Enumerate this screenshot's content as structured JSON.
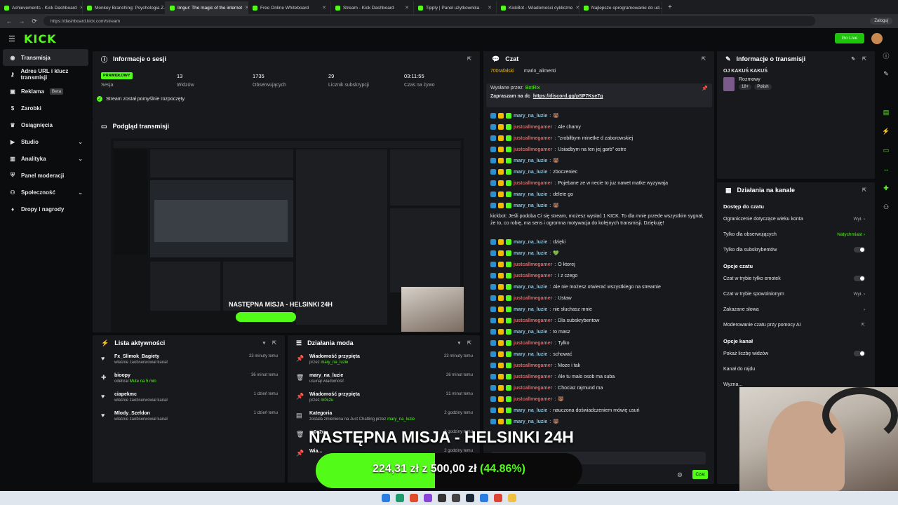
{
  "browser": {
    "tabs": [
      {
        "label": "Achievements - Kick Dashboard",
        "active": false
      },
      {
        "label": "Monkey Branching: Psychologia Z...",
        "active": false
      },
      {
        "label": "Imgur: The magic of the internet",
        "active": true
      },
      {
        "label": "Free Online Whiteboard",
        "active": false
      },
      {
        "label": "Stream - Kick Dashboard",
        "active": false
      },
      {
        "label": "Tipply | Panel użytkownika",
        "active": false
      },
      {
        "label": "KickBot - Wiadomości cykliczne",
        "active": false
      },
      {
        "label": "Najlepsze oprogramowanie do ud...",
        "active": false
      }
    ],
    "url": "https://dashboard.kick.com/stream",
    "profile_label": "Zaloguj"
  },
  "header": {
    "logo": "KICK",
    "golive_label": "Go Live"
  },
  "sidebar": {
    "items": [
      {
        "label": "Transmisja",
        "icon": "broadcast-icon",
        "active": true
      },
      {
        "label": "Adres URL i klucz transmisji",
        "icon": "key-icon"
      },
      {
        "label": "Reklama",
        "icon": "ad-icon",
        "badge": "Beta"
      },
      {
        "label": "Zarobki",
        "icon": "money-icon"
      },
      {
        "label": "Osiągnięcia",
        "icon": "trophy-icon"
      },
      {
        "label": "Studio",
        "icon": "studio-icon",
        "chevron": true
      },
      {
        "label": "Analityka",
        "icon": "chart-icon",
        "chevron": true
      },
      {
        "label": "Panel moderacji",
        "icon": "shield-icon"
      },
      {
        "label": "Społeczność",
        "icon": "community-icon",
        "chevron": true
      },
      {
        "label": "Dropy i nagrody",
        "icon": "gift-icon"
      }
    ]
  },
  "session": {
    "title": "Informacje o sesji",
    "status_badge": "PRAWIDŁOWY",
    "stats": [
      {
        "value": "",
        "label": "Sesja"
      },
      {
        "value": "13",
        "label": "Widzów"
      },
      {
        "value": "1735",
        "label": "Obserwujących"
      },
      {
        "value": "29",
        "label": "Licznik subskrypcji"
      },
      {
        "value": "03:11:55",
        "label": "Czas na żywo"
      }
    ],
    "message": "Stream został pomyślnie rozpoczęty."
  },
  "preview": {
    "title": "Podgląd transmisji"
  },
  "activity": {
    "title": "Lista aktywności",
    "items": [
      {
        "name": "Fx_Slimok_Bagiety",
        "sub": "właśnie zaobserwował kanał",
        "time": "23 minuty temu",
        "icon": "heart-icon"
      },
      {
        "name": "bioopy",
        "sub": "odebrał",
        "sub_hl": "Mute na 5 min",
        "time": "36 minut temu",
        "icon": "gift-icon"
      },
      {
        "name": "ciapekmc",
        "sub": "właśnie zaobserwował kanał",
        "time": "1 dzień temu",
        "icon": "heart-icon"
      },
      {
        "name": "Mlody_Szeldon",
        "sub": "właśnie zaobserwował kanał",
        "time": "1 dzień temu",
        "icon": "heart-icon"
      }
    ]
  },
  "modlog": {
    "title": "Działania moda",
    "items": [
      {
        "name": "Wiadomość przypięta",
        "sub": "przez",
        "sub_hl": "mary_na_luzie",
        "time": "23 minuty temu",
        "icon": "pin-icon"
      },
      {
        "name": "mary_na_luzie",
        "sub": "usunął wiadomość",
        "time": "26 minut temu",
        "icon": "trash-icon"
      },
      {
        "name": "Wiadomość przypięta",
        "sub": "przez",
        "sub_hl": "m0c2u",
        "time": "31 minut temu",
        "icon": "pin-icon"
      },
      {
        "name": "Kategoria",
        "sub": "została zmieniona na Just Chatting przez",
        "sub_hl": "mary_na_luzie",
        "time": "2 godziny temu",
        "icon": "tag-icon"
      },
      {
        "name": "m0c2u",
        "sub": "",
        "time": "2 godziny temu",
        "icon": "trash-icon"
      },
      {
        "name": "Wia...",
        "sub": "",
        "time": "2 godziny temu",
        "icon": "pin-icon"
      }
    ]
  },
  "chat": {
    "title": "Czat",
    "top_users": [
      "700rafalski",
      "mario_alimenti"
    ],
    "pinned_by": "Wysłane przez",
    "pinned_user": "BotRix",
    "pinned_text": "Zapraszam na dc",
    "pinned_link": "https://discord.gg/pSP7Kse7g",
    "messages": [
      {
        "user": "mary_na_luzie",
        "text": "🐻",
        "color": "m"
      },
      {
        "user": "justcallmegamer",
        "text": "Ale chamy",
        "color": "j"
      },
      {
        "user": "justcallmegamer",
        "text": "\"zrobiłbym minetke d zaborowskiej",
        "color": "j"
      },
      {
        "user": "justcallmegamer",
        "text": "Usiadbym na ten jej garb\" ostre",
        "color": "j"
      },
      {
        "user": "mary_na_luzie",
        "text": "🐻",
        "color": "m"
      },
      {
        "user": "mary_na_luzie",
        "text": "zboczeniec",
        "color": "m"
      },
      {
        "user": "justcallmegamer",
        "text": "Pojebane ze w necie to juz nawet matke wyzywaja",
        "color": "j"
      },
      {
        "user": "mary_na_luzie",
        "text": "delete go",
        "color": "m"
      },
      {
        "user": "mary_na_luzie",
        "text": "🐻",
        "color": "m"
      }
    ],
    "bot_message": "kickbot: Jeśli podoba Ci się stream, możesz wysłać 1 KICK. To dla mnie przede wszystkim sygnał, że to, co robię, ma sens i ogromna motywacja do kolejnych transmisji. Dziękuję!",
    "messages2": [
      {
        "user": "mary_na_luzie",
        "text": "dzięki",
        "color": "m"
      },
      {
        "user": "mary_na_luzie",
        "text": "💚",
        "color": "m"
      },
      {
        "user": "justcallmegamer",
        "text": "O ktorej",
        "color": "j"
      },
      {
        "user": "justcallmegamer",
        "text": "I z czego",
        "color": "j"
      },
      {
        "user": "mary_na_luzie",
        "text": "Ale nie możesz otwierać wszystkiego na streamie",
        "color": "m"
      },
      {
        "user": "justcallmegamer",
        "text": "Ustaw",
        "color": "j"
      },
      {
        "user": "mary_na_luzie",
        "text": "nie słuchasz mnie",
        "color": "m"
      },
      {
        "user": "justcallmegamer",
        "text": "Dla subskrybentow",
        "color": "j"
      },
      {
        "user": "mary_na_luzie",
        "text": "to masz",
        "color": "m"
      },
      {
        "user": "justcallmegamer",
        "text": "Tylko",
        "color": "j"
      },
      {
        "user": "mary_na_luzie",
        "text": "schować",
        "color": "m"
      },
      {
        "user": "justcallmegamer",
        "text": "Moze i tak",
        "color": "j"
      },
      {
        "user": "justcallmegamer",
        "text": "Ale tu malo osob ma suba",
        "color": "j"
      },
      {
        "user": "justcallmegamer",
        "text": "Chociaz rajmund ma",
        "color": "j"
      },
      {
        "user": "justcallmegamer",
        "text": "🐻",
        "color": "j"
      },
      {
        "user": "mary_na_luzie",
        "text": "nauczona doświadczeniem mówię usuń",
        "color": "m"
      },
      {
        "user": "mary_na_luzie",
        "text": "🐻",
        "color": "m"
      }
    ],
    "input_placeholder": "Wyślij wiadomość",
    "send_label": "Czat"
  },
  "info": {
    "title": "Informacje o transmisji",
    "stream_title": "OJ KAKUŚ KAKUŚ",
    "category": "Rozmowy",
    "tags": [
      "18+",
      "Polish"
    ]
  },
  "actions": {
    "title": "Działania na kanale",
    "sections": [
      {
        "heading": "Dostęp do czatu",
        "options": [
          {
            "label": "Ograniczenie dotyczące wieku konta",
            "value": "Wył.",
            "kind": "arrow"
          },
          {
            "label": "Tylko dla obserwujących",
            "value": "Natychmiast",
            "kind": "arrow-green"
          },
          {
            "label": "Tylko dla subskrybentów",
            "kind": "toggle"
          }
        ]
      },
      {
        "heading": "Opcje czatu",
        "options": [
          {
            "label": "Czat w trybie tylko emotek",
            "kind": "toggle"
          },
          {
            "label": "Czat w trybie spowolnionym",
            "value": "Wył.",
            "kind": "arrow"
          },
          {
            "label": "Zakazane słowa",
            "kind": "arrow"
          },
          {
            "label": "Moderowanie czatu przy pomocy AI",
            "kind": "link"
          }
        ]
      },
      {
        "heading": "Opcje kanał",
        "options": [
          {
            "label": "Pokaż liczbę widzów",
            "kind": "toggle"
          },
          {
            "label": "Kanał do rajdu",
            "kind": "none"
          },
          {
            "label": "Wyzna...",
            "kind": "none"
          }
        ]
      }
    ]
  },
  "overlay": {
    "goal_title": "NASTĘPNA MISJA - HELSINKI 24H",
    "goal_current": "224,31 zł",
    "goal_connector": "z",
    "goal_target": "500,00 zł",
    "goal_percent": "(44.86%)",
    "goal_fraction": 0.4486
  },
  "colors": {
    "accent": "#53fc18",
    "panel": "#18191c",
    "bg": "#0b0c0e"
  }
}
